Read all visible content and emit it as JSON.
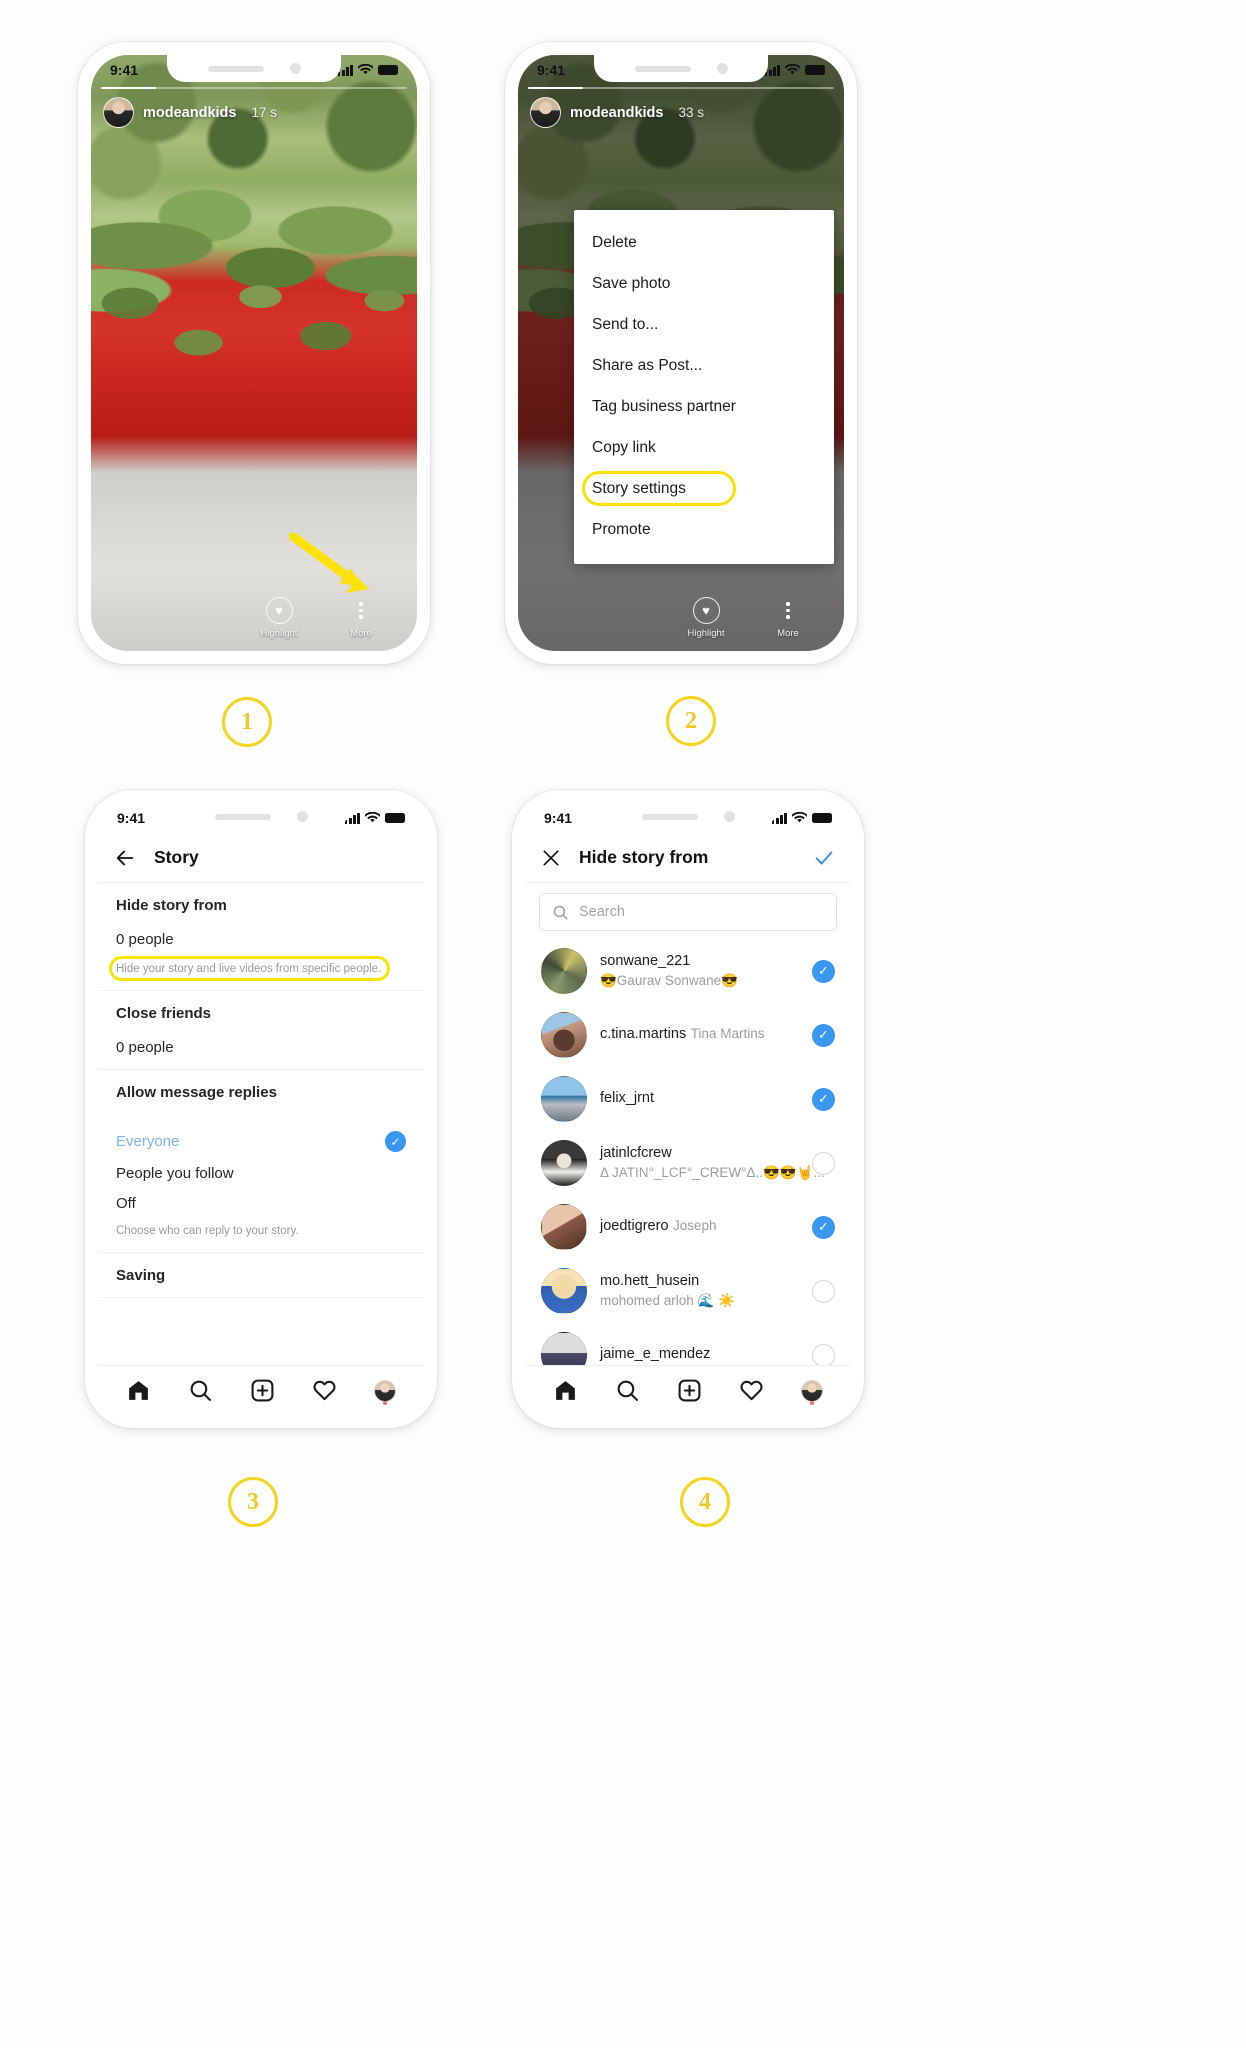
{
  "steps": [
    {
      "number": "1"
    },
    {
      "number": "2"
    },
    {
      "number": "3"
    },
    {
      "number": "4"
    }
  ],
  "colors": {
    "highlight_yellow": "#fae300",
    "badge_yellow": "#f5d321",
    "instagram_blue": "#3897f0",
    "selected_text_blue": "#7cb4e8"
  },
  "phone1": {
    "status_time": "9:41",
    "story": {
      "username": "modeandkids",
      "time_ago": "17 s",
      "actions": [
        {
          "label": "Highlight",
          "icon": "heart-icon"
        },
        {
          "label": "More",
          "icon": "more-dots-icon"
        }
      ]
    }
  },
  "phone2": {
    "status_time": "9:41",
    "story": {
      "username": "modeandkids",
      "time_ago": "33 s",
      "actions": [
        {
          "label": "Highlight",
          "icon": "heart-icon"
        },
        {
          "label": "More",
          "icon": "more-dots-icon"
        }
      ]
    },
    "menu": {
      "items": [
        {
          "label": "Delete",
          "highlighted": false
        },
        {
          "label": "Save photo",
          "highlighted": false
        },
        {
          "label": "Send to...",
          "highlighted": false
        },
        {
          "label": "Share as Post...",
          "highlighted": false
        },
        {
          "label": "Tag business partner",
          "highlighted": false
        },
        {
          "label": "Copy link",
          "highlighted": false
        },
        {
          "label": "Story settings",
          "highlighted": true
        },
        {
          "label": "Promote",
          "highlighted": false
        }
      ]
    }
  },
  "phone3": {
    "status_time": "9:41",
    "header": {
      "title": "Story",
      "back_icon": "back-arrow-icon"
    },
    "sections": {
      "hide_story": {
        "title": "Hide story from",
        "value": "0 people",
        "hint": "Hide your story and live videos from specific people."
      },
      "close_friends": {
        "title": "Close friends",
        "value": "0 people"
      },
      "allow_replies": {
        "title": "Allow message replies",
        "options": [
          {
            "label": "Everyone",
            "selected": true
          },
          {
            "label": "People you follow",
            "selected": false
          },
          {
            "label": "Off",
            "selected": false
          }
        ],
        "hint": "Choose who can reply to your story."
      },
      "saving": {
        "title": "Saving"
      }
    },
    "tabbar": [
      {
        "name": "home-icon"
      },
      {
        "name": "search-icon"
      },
      {
        "name": "add-post-icon"
      },
      {
        "name": "activity-heart-icon"
      },
      {
        "name": "profile-avatar"
      }
    ]
  },
  "phone4": {
    "status_time": "9:41",
    "header": {
      "title": "Hide story from",
      "close_icon": "close-x-icon",
      "confirm_icon": "check-icon"
    },
    "search": {
      "placeholder": "Search"
    },
    "people": [
      {
        "username": "sonwane_221",
        "fullname": "😎Gaurav Sonwane😎",
        "selected": true,
        "avatar": "a1"
      },
      {
        "username": "c.tina.martins",
        "fullname": "Tina Martins",
        "selected": true,
        "avatar": "a2"
      },
      {
        "username": "felix_jrnt",
        "fullname": "",
        "selected": true,
        "avatar": "a3"
      },
      {
        "username": "jatinlcfcrew",
        "fullname": "Δ JATIN°_LCF°_CREW°Δ..😎😎🤘...",
        "selected": false,
        "avatar": "a4"
      },
      {
        "username": "joedtigrero",
        "fullname": "Joseph",
        "selected": true,
        "avatar": "a5"
      },
      {
        "username": "mo.hett_husein",
        "fullname": "mohomed arloh 🌊 ☀️",
        "selected": false,
        "avatar": "a6"
      },
      {
        "username": "jaime_e_mendez",
        "fullname": "",
        "selected": false,
        "avatar": "a7"
      }
    ],
    "tabbar": [
      {
        "name": "home-icon"
      },
      {
        "name": "search-icon"
      },
      {
        "name": "add-post-icon"
      },
      {
        "name": "activity-heart-icon"
      },
      {
        "name": "profile-avatar"
      }
    ]
  }
}
